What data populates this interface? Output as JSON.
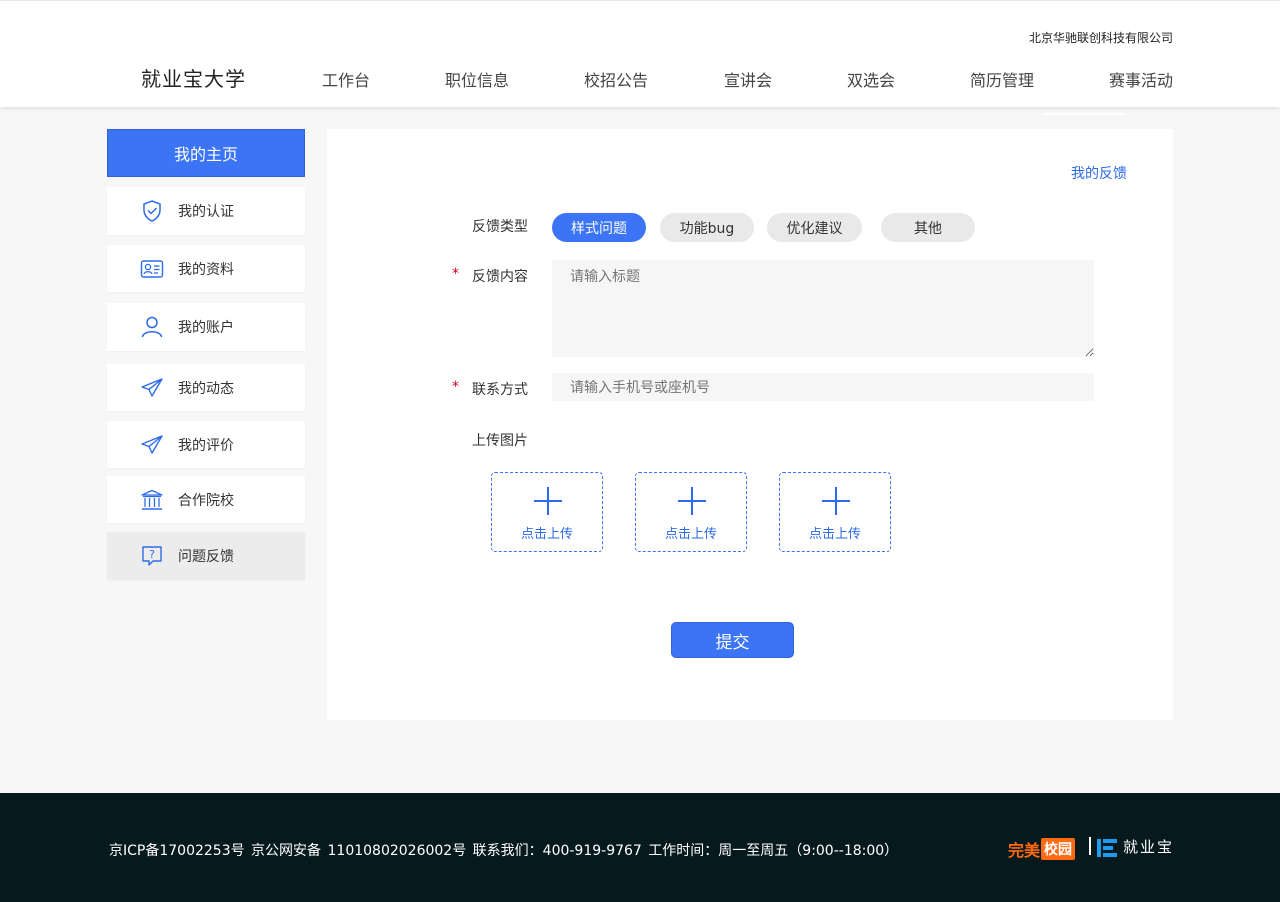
{
  "header": {
    "company": "北京华驰联创科技有限公司",
    "logo": "就业宝大学",
    "nav": [
      "工作台",
      "职位信息",
      "校招公告",
      "宣讲会",
      "双选会",
      "简历管理",
      "赛事活动"
    ]
  },
  "sidebar": {
    "home": "我的主页",
    "items": [
      {
        "label": "我的认证",
        "icon": "shield-check-icon"
      },
      {
        "label": "我的资料",
        "icon": "profile-card-icon"
      },
      {
        "label": "我的账户",
        "icon": "user-icon"
      },
      {
        "label": "我的动态",
        "icon": "paper-plane-icon"
      },
      {
        "label": "我的评价",
        "icon": "paper-plane-icon"
      },
      {
        "label": "合作院校",
        "icon": "institution-icon"
      },
      {
        "label": "问题反馈",
        "icon": "question-bubble-icon"
      }
    ],
    "active_item": "问题反馈"
  },
  "main": {
    "my_feedback_link": "我的反馈",
    "type_label": "反馈类型",
    "types": [
      "样式问题",
      "功能bug",
      "优化建议",
      "其他"
    ],
    "selected_type": "样式问题",
    "required_mark": "*",
    "content_label": "反馈内容",
    "content_placeholder": "请输入标题",
    "contact_label": "联系方式",
    "contact_placeholder": "请输入手机号或座机号",
    "upload_label": "上传图片",
    "upload_slots": [
      "点击上传",
      "点击上传",
      "点击上传"
    ],
    "submit": "提交"
  },
  "footer": {
    "text": "京ICP备17002253号    京公网安备 11010802026002号    联系我们：400-919-9767    工作时间：周一至周五（9:00--18:00）",
    "brand1_a": "完美",
    "brand1_b": "校园",
    "brand2": "就业宝"
  },
  "colors": {
    "accent": "#3b74f5",
    "link": "#2d6bea",
    "footer_bg": "#06191c",
    "brand_orange": "#ff6a13",
    "brand_blue": "#1e9bf0"
  }
}
